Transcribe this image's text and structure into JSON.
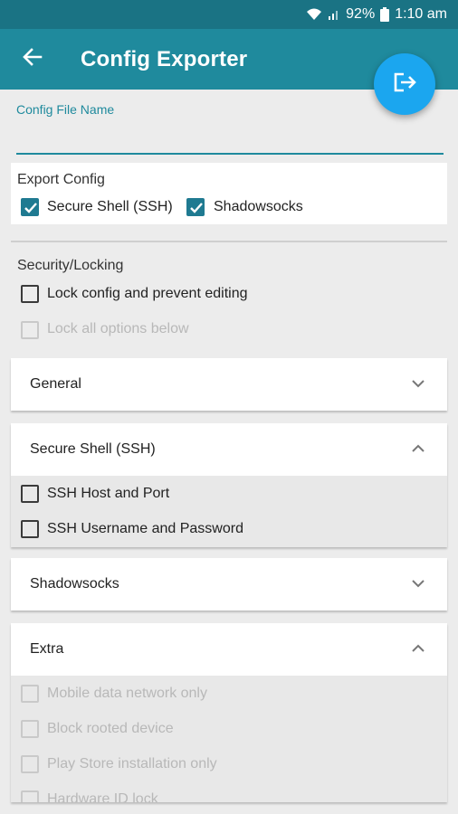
{
  "status_bar": {
    "battery": "92%",
    "time": "1:10 am",
    "icons": [
      "wifi-icon",
      "signal-icon",
      "battery-icon"
    ]
  },
  "app_bar": {
    "title": "Config Exporter",
    "back_icon": "arrow-left-icon",
    "action_icon": "export-icon"
  },
  "config_file": {
    "label": "Config File Name",
    "value": ""
  },
  "export_config": {
    "title": "Export Config",
    "options": [
      {
        "label": "Secure Shell (SSH)",
        "checked": true
      },
      {
        "label": "Shadowsocks",
        "checked": true
      }
    ]
  },
  "security": {
    "title": "Security/Locking",
    "options": [
      {
        "label": "Lock config and prevent editing",
        "checked": false,
        "enabled": true
      },
      {
        "label": "Lock all options below",
        "checked": false,
        "enabled": false
      }
    ]
  },
  "sections": [
    {
      "title": "General",
      "expanded": false,
      "items": []
    },
    {
      "title": "Secure Shell (SSH)",
      "expanded": true,
      "items": [
        {
          "label": "SSH Host and Port",
          "checked": false,
          "enabled": true
        },
        {
          "label": "SSH Username and Password",
          "checked": false,
          "enabled": true
        }
      ]
    },
    {
      "title": "Shadowsocks",
      "expanded": false,
      "items": []
    },
    {
      "title": "Extra",
      "expanded": true,
      "items": [
        {
          "label": "Mobile data network only",
          "checked": false,
          "enabled": false
        },
        {
          "label": "Block rooted device",
          "checked": false,
          "enabled": false
        },
        {
          "label": "Play Store installation only",
          "checked": false,
          "enabled": false
        },
        {
          "label": "Hardware ID lock",
          "checked": false,
          "enabled": false
        }
      ]
    }
  ],
  "colors": {
    "app_bar": "#1f8a9d",
    "status_bar": "#1a7384",
    "fab": "#1ba6ef",
    "checkbox_checked": "#1f7a91"
  }
}
